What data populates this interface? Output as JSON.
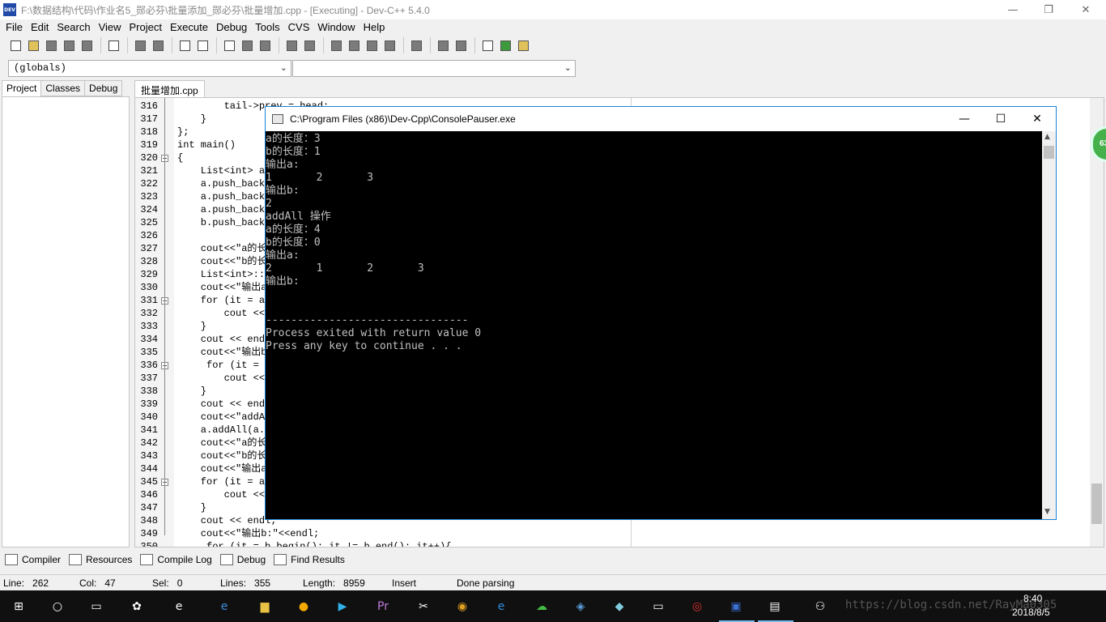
{
  "window": {
    "title": "F:\\数据结构\\代码\\作业名5_郧必芬\\批量添加_郧必芬\\批量增加.cpp - [Executing] - Dev-C++ 5.4.0",
    "app_icon_label": "DEV"
  },
  "menu": [
    "File",
    "Edit",
    "Search",
    "View",
    "Project",
    "Execute",
    "Debug",
    "Tools",
    "CVS",
    "Window",
    "Help"
  ],
  "globals_combo": "(globals)",
  "left_tabs": [
    "Project",
    "Classes",
    "Debug"
  ],
  "editor": {
    "file_tab": "批量增加.cpp",
    "lines": [
      {
        "n": "316",
        "text": "        tail->prev = head;"
      },
      {
        "n": "317",
        "text": "    }"
      },
      {
        "n": "318",
        "text": "};"
      },
      {
        "n": "319",
        "text": "int main()"
      },
      {
        "n": "320",
        "text": "{"
      },
      {
        "n": "321",
        "text": "    List<int> a"
      },
      {
        "n": "322",
        "text": "    a.push_back"
      },
      {
        "n": "323",
        "text": "    a.push_back"
      },
      {
        "n": "324",
        "text": "    a.push_back"
      },
      {
        "n": "325",
        "text": "    b.push_back"
      },
      {
        "n": "326",
        "text": ""
      },
      {
        "n": "327",
        "text": "    cout<<\"a的长"
      },
      {
        "n": "328",
        "text": "    cout<<\"b的长"
      },
      {
        "n": "329",
        "text": "    List<int>::"
      },
      {
        "n": "330",
        "text": "    cout<<\"输出a"
      },
      {
        "n": "331",
        "text": "    for (it = a"
      },
      {
        "n": "332",
        "text": "        cout <<"
      },
      {
        "n": "333",
        "text": "    }"
      },
      {
        "n": "334",
        "text": "    cout << endl"
      },
      {
        "n": "335",
        "text": "    cout<<\"输出b"
      },
      {
        "n": "336",
        "text": "     for (it = b"
      },
      {
        "n": "337",
        "text": "        cout <<"
      },
      {
        "n": "338",
        "text": "    }"
      },
      {
        "n": "339",
        "text": "    cout << endl"
      },
      {
        "n": "340",
        "text": "    cout<<\"addAl"
      },
      {
        "n": "341",
        "text": "    a.addAll(a.b"
      },
      {
        "n": "342",
        "text": "    cout<<\"a的长"
      },
      {
        "n": "343",
        "text": "    cout<<\"b的长"
      },
      {
        "n": "344",
        "text": "    cout<<\"输出a"
      },
      {
        "n": "345",
        "text": "    for (it = a"
      },
      {
        "n": "346",
        "text": "        cout <<"
      },
      {
        "n": "347",
        "text": "    }"
      },
      {
        "n": "348",
        "text": "    cout << endl;"
      },
      {
        "n": "349",
        "text": "    cout<<\"输出b:\"<<endl;"
      },
      {
        "n": "350",
        "text": "     for (it = b.begin(); it != b.end(); it++){"
      }
    ]
  },
  "console": {
    "title": "C:\\Program Files (x86)\\Dev-Cpp\\ConsolePauser.exe",
    "lines": [
      "a的长度：3",
      "b的长度：1",
      "输出a:",
      "1       2       3",
      "输出b:",
      "2",
      "addAll 操作",
      "a的长度：4",
      "b的长度：0",
      "输出a:",
      "2       1       2       3",
      "输出b:",
      "",
      "",
      "--------------------------------",
      "Process exited with return value 0",
      "Press any key to continue . . ."
    ]
  },
  "badge": "63",
  "bottom_tabs": [
    "Compiler",
    "Resources",
    "Compile Log",
    "Debug",
    "Find Results"
  ],
  "status": {
    "line_label": "Line:",
    "line": "262",
    "col_label": "Col:",
    "col": "47",
    "sel_label": "Sel:",
    "sel": "0",
    "lines_label": "Lines:",
    "lines": "355",
    "length_label": "Length:",
    "length": "8959",
    "mode": "Insert",
    "message": "Done parsing"
  },
  "taskbar": {
    "tray_text": "https://blog.csdn.net/RayMa0305",
    "time": "8:40",
    "date": "2018/8/5"
  }
}
